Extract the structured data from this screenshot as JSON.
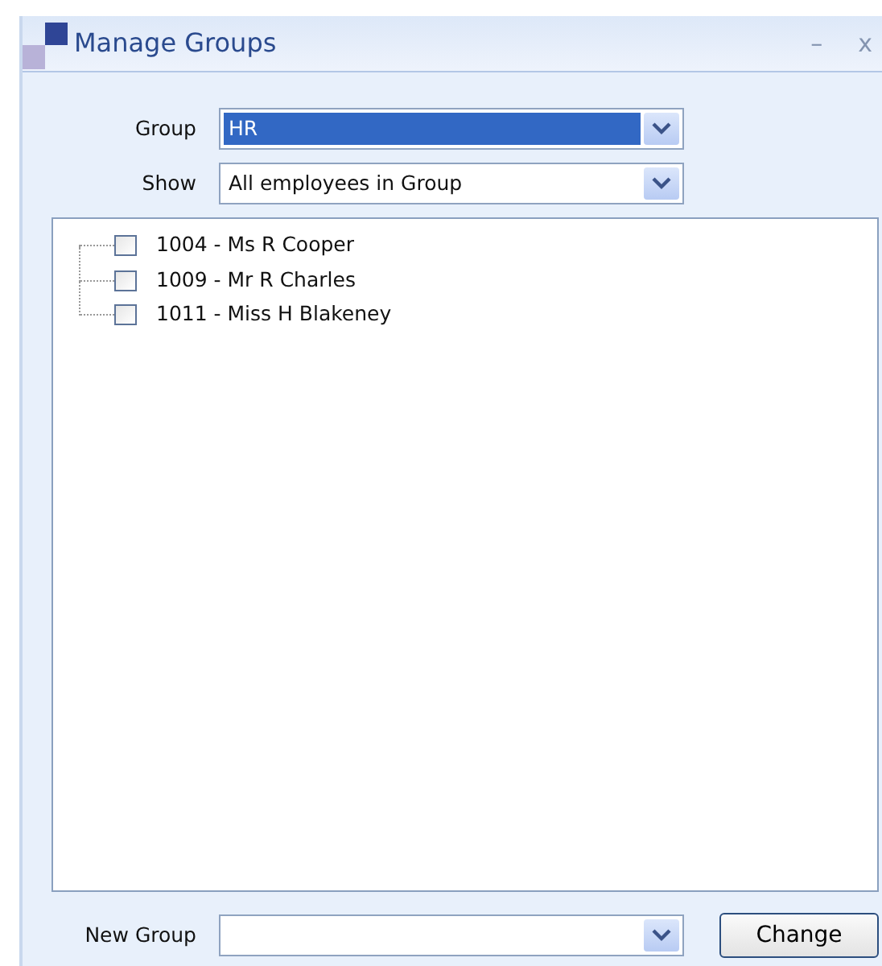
{
  "window": {
    "title": "Manage Groups",
    "controls": [
      "–",
      "x"
    ]
  },
  "group": {
    "label": "Group",
    "value": "HR",
    "focused": true
  },
  "show": {
    "label": "Show",
    "value": "All employees in Group",
    "focused": false
  },
  "tree": {
    "items": [
      {
        "label": "1004 - Ms R Cooper",
        "checked": false
      },
      {
        "label": "1009 - Mr R Charles",
        "checked": false
      },
      {
        "label": "1011 - Miss H Blakeney",
        "checked": false
      }
    ]
  },
  "new_group": {
    "label": "New Group",
    "focused": false
  },
  "buttons": [
    "Change"
  ]
}
